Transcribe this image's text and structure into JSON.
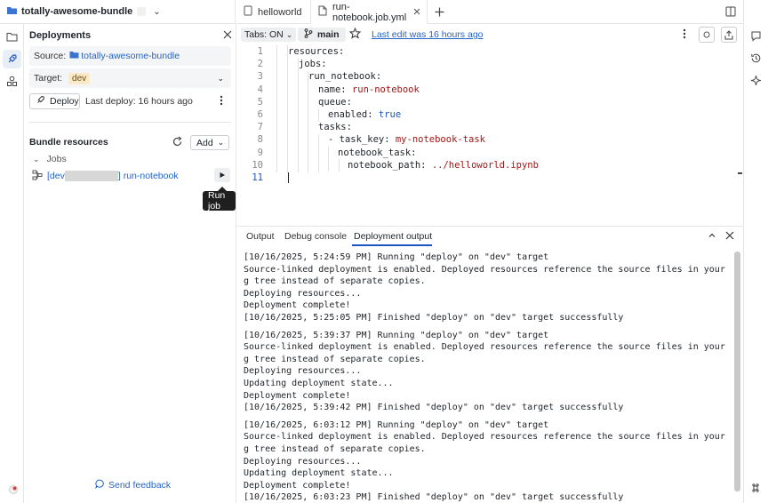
{
  "header": {
    "bundle_name": "totally-awesome-bundle"
  },
  "panel": {
    "title": "Deployments",
    "source_label": "Source:",
    "source_value": "totally-awesome-bundle",
    "target_label": "Target:",
    "target_value": "dev",
    "deploy_label": "Deploy",
    "last_deploy": "Last deploy: 16 hours ago",
    "resources_title": "Bundle resources",
    "add_label": "Add",
    "jobs_group": "Jobs",
    "job_prefix": "[dev",
    "job_suffix": "] run-notebook",
    "tooltip": "Run job",
    "feedback": "Send feedback"
  },
  "tabs": [
    {
      "label": "helloworld"
    },
    {
      "label": "run-notebook.job.yml"
    }
  ],
  "toolbar": {
    "tabs_label": "Tabs: ON",
    "branch": "main",
    "last_edit": "Last edit was 16 hours ago"
  },
  "code": {
    "line_numbers": [
      "1",
      "2",
      "3",
      "4",
      "5",
      "6",
      "7",
      "8",
      "9",
      "10",
      "11"
    ],
    "l1": "resources:",
    "l2": "jobs:",
    "l3": "run_notebook:",
    "l4_key": "name: ",
    "l4_val": "run-notebook",
    "l5": "queue:",
    "l6_key": "enabled: ",
    "l6_val": "true",
    "l7": "tasks:",
    "l8_key": "- task_key: ",
    "l8_val": "my-notebook-task",
    "l9": "notebook_task:",
    "l10_key": "notebook_path: ",
    "l10_val": "../helloworld.ipynb"
  },
  "output": {
    "tabs": [
      "Output",
      "Debug console",
      "Deployment output"
    ],
    "log": [
      "[10/16/2025, 5:24:59 PM] Running \"deploy\" on \"dev\" target",
      "Source-linked deployment is enabled. Deployed resources reference the source files in your workin",
      "g tree instead of separate copies.",
      "Deploying resources...",
      "Deployment complete!",
      "[10/16/2025, 5:25:05 PM] Finished \"deploy\" on \"dev\" target successfully",
      "",
      "[10/16/2025, 5:39:37 PM] Running \"deploy\" on \"dev\" target",
      "Source-linked deployment is enabled. Deployed resources reference the source files in your workin",
      "g tree instead of separate copies.",
      "Deploying resources...",
      "Updating deployment state...",
      "Deployment complete!",
      "[10/16/2025, 5:39:42 PM] Finished \"deploy\" on \"dev\" target successfully",
      "",
      "[10/16/2025, 6:03:12 PM] Running \"deploy\" on \"dev\" target",
      "Source-linked deployment is enabled. Deployed resources reference the source files in your workin",
      "g tree instead of separate copies.",
      "Deploying resources...",
      "Updating deployment state...",
      "Deployment complete!",
      "[10/16/2025, 6:03:23 PM] Finished \"deploy\" on \"dev\" target successfully"
    ]
  },
  "colors": {
    "accent": "#1a54c4",
    "link": "#2563c7",
    "target_tag": "#fbe9c8"
  }
}
